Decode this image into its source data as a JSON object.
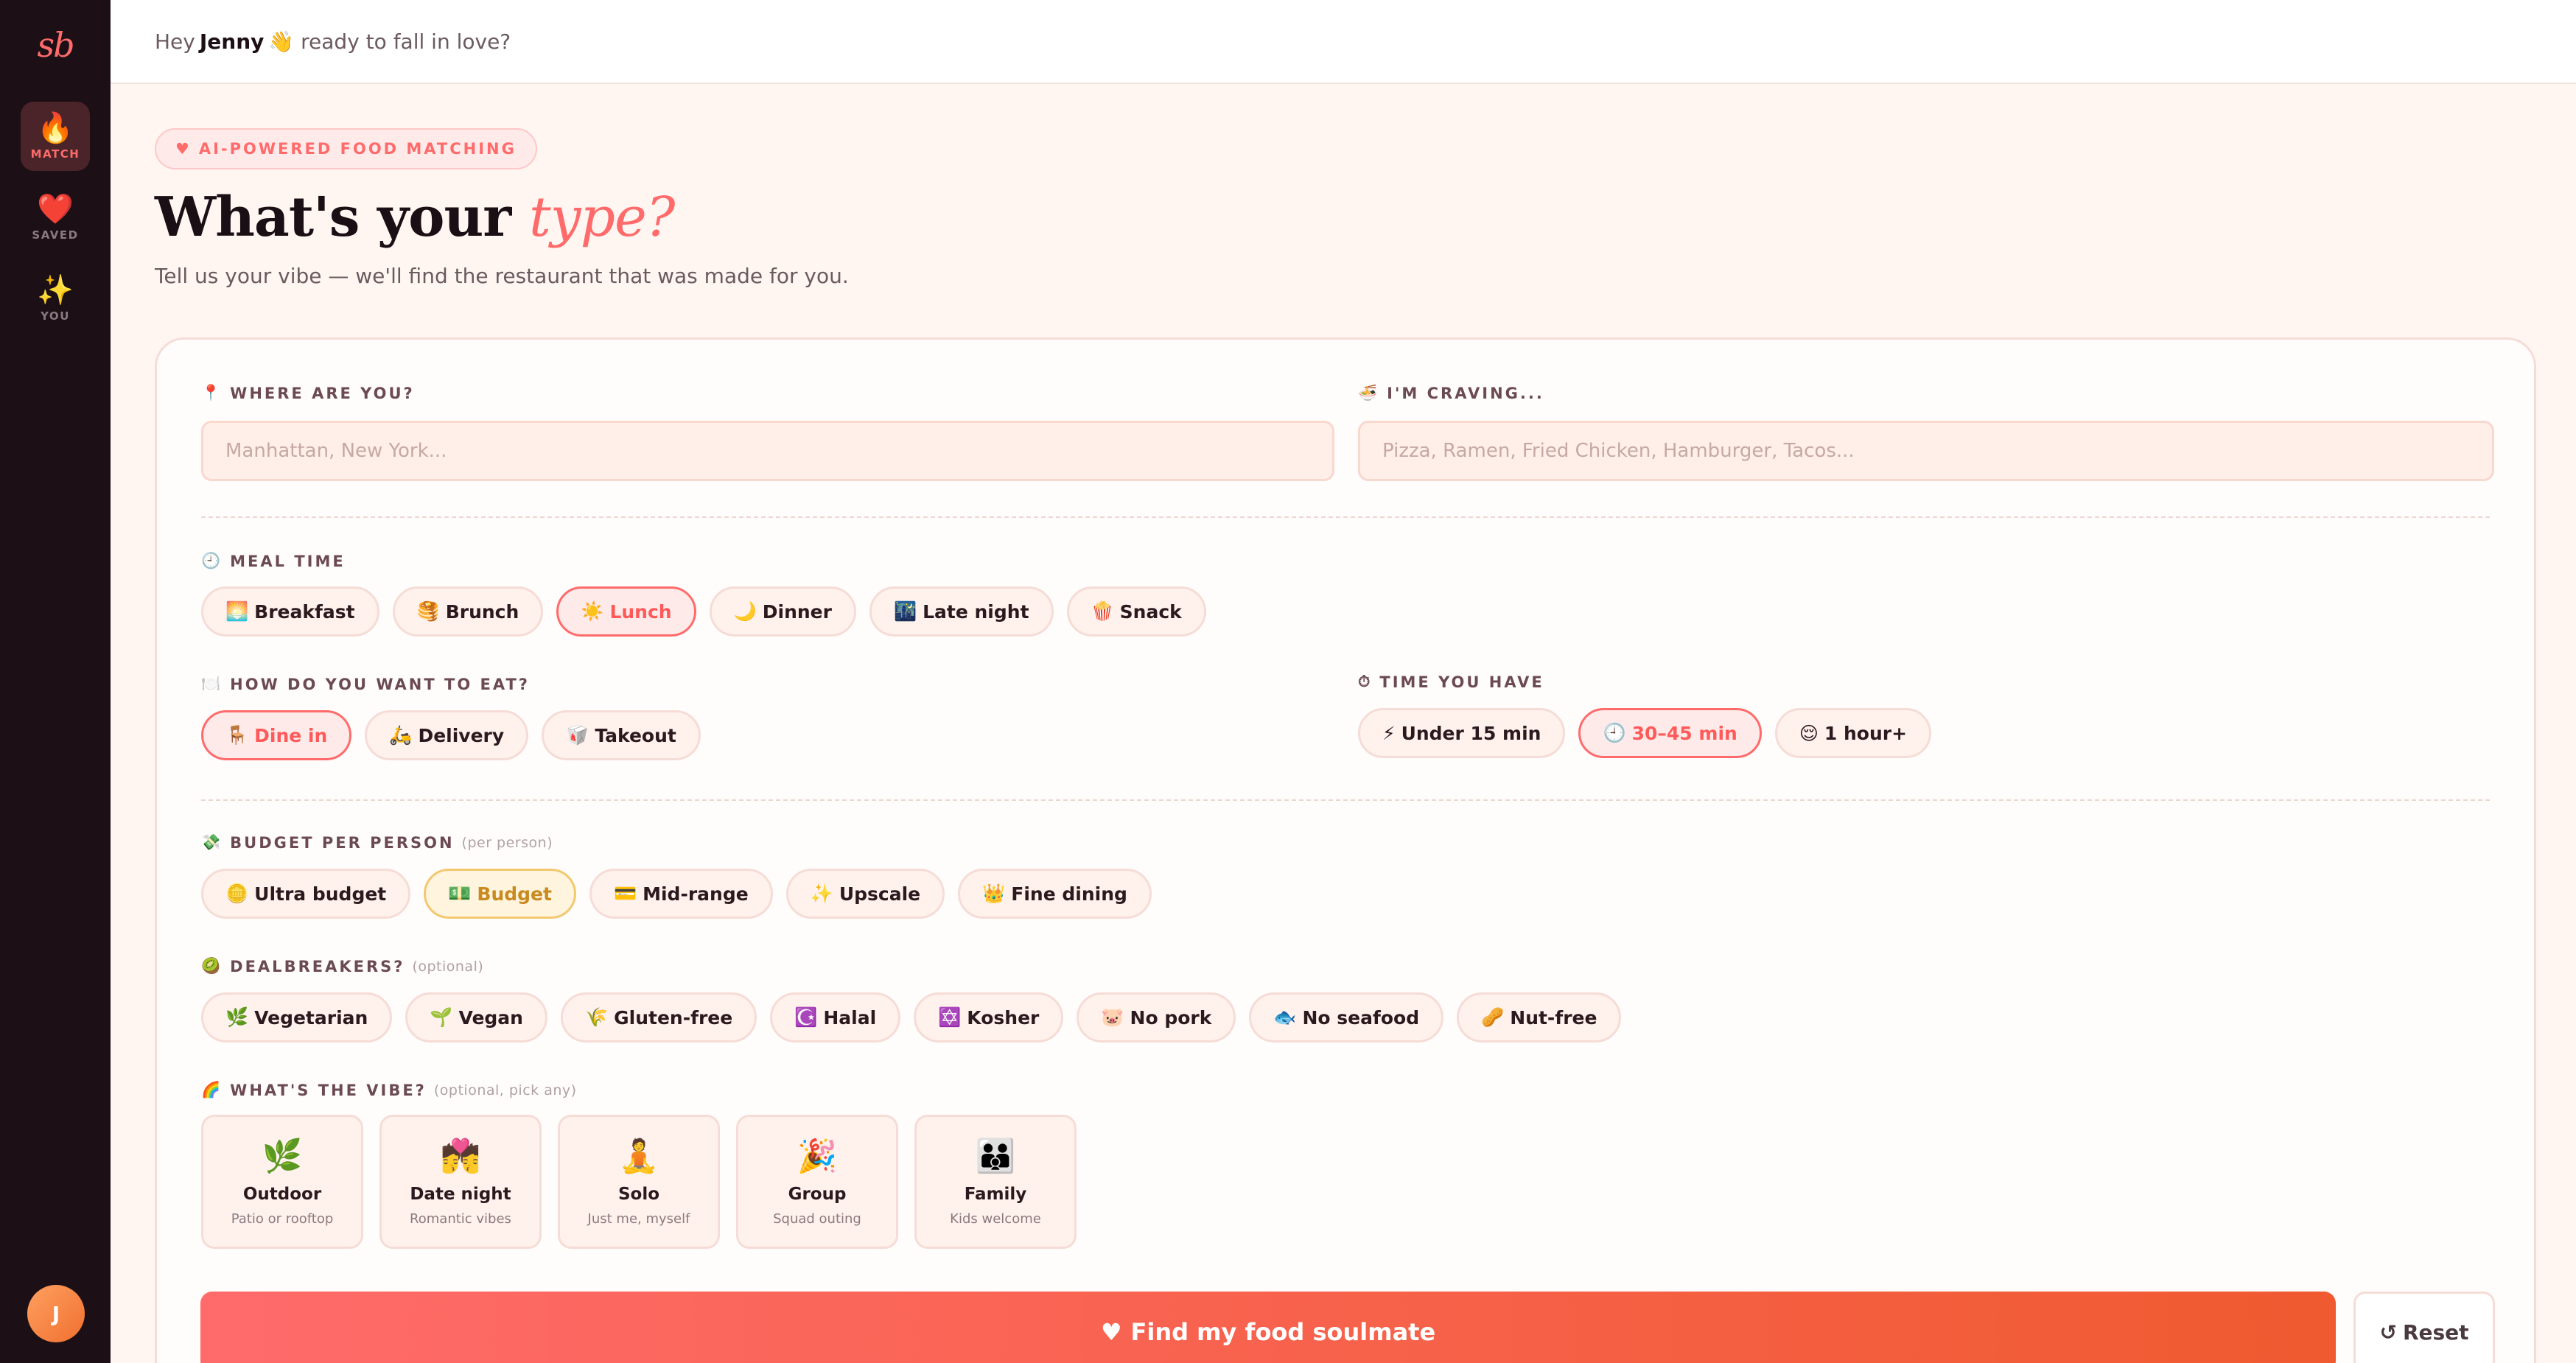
{
  "sidebar": {
    "logo": "sb",
    "items": [
      {
        "icon": "🔥",
        "label": "MATCH"
      },
      {
        "icon": "❤️",
        "label": "SAVED"
      },
      {
        "icon": "✨",
        "label": "YOU"
      }
    ],
    "avatar": "J"
  },
  "topbar": {
    "greeting_pre": "Hey",
    "name": "Jenny",
    "greeting_post": "👋 ready to fall in love?"
  },
  "hero": {
    "badge_icon": "♥",
    "badge": "AI-POWERED FOOD MATCHING",
    "title_main": "What's your",
    "title_accent": "type?",
    "subtitle": "Tell us your vibe — we'll find the restaurant that was made for you."
  },
  "form": {
    "location": {
      "icon": "📍",
      "label": "WHERE ARE YOU?",
      "placeholder": "Manhattan, New York...",
      "value": ""
    },
    "craving": {
      "icon": "🍜",
      "label": "I'M CRAVING...",
      "placeholder": "Pizza, Ramen, Fried Chicken, Hamburger, Tacos...",
      "value": ""
    },
    "meal_time": {
      "icon": "🕘",
      "label": "MEAL TIME",
      "selected": "Lunch",
      "options": [
        {
          "icon": "🌅",
          "label": "Breakfast"
        },
        {
          "icon": "🥞",
          "label": "Brunch"
        },
        {
          "icon": "☀️",
          "label": "Lunch"
        },
        {
          "icon": "🌙",
          "label": "Dinner"
        },
        {
          "icon": "🌃",
          "label": "Late night"
        },
        {
          "icon": "🍿",
          "label": "Snack"
        }
      ]
    },
    "eat_mode": {
      "icon": "🍽️",
      "label": "HOW DO YOU WANT TO EAT?",
      "selected": "Dine in",
      "options": [
        {
          "icon": "🪑",
          "label": "Dine in"
        },
        {
          "icon": "🛵",
          "label": "Delivery"
        },
        {
          "icon": "🥡",
          "label": "Takeout"
        }
      ]
    },
    "time_available": {
      "icon": "⏱",
      "label": "TIME YOU HAVE",
      "selected": "30–45 min",
      "options": [
        {
          "icon": "⚡",
          "label": "Under 15 min"
        },
        {
          "icon": "🕘",
          "label": "30–45 min"
        },
        {
          "icon": "😌",
          "label": "1 hour+"
        }
      ]
    },
    "budget": {
      "icon": "💸",
      "label": "BUDGET PER PERSON",
      "hint": "(per person)",
      "selected": "Budget",
      "options": [
        {
          "icon": "🪙",
          "label": "Ultra budget"
        },
        {
          "icon": "💵",
          "label": "Budget"
        },
        {
          "icon": "💳",
          "label": "Mid-range"
        },
        {
          "icon": "✨",
          "label": "Upscale"
        },
        {
          "icon": "👑",
          "label": "Fine dining"
        }
      ]
    },
    "dealbreakers": {
      "icon": "🥝",
      "label": "DEALBREAKERS?",
      "hint": "(optional)",
      "options": [
        {
          "icon": "🌿",
          "label": "Vegetarian"
        },
        {
          "icon": "🌱",
          "label": "Vegan"
        },
        {
          "icon": "🌾",
          "label": "Gluten-free"
        },
        {
          "icon": "☪️",
          "label": "Halal"
        },
        {
          "icon": "✡️",
          "label": "Kosher"
        },
        {
          "icon": "🐷",
          "label": "No pork"
        },
        {
          "icon": "🐟",
          "label": "No seafood"
        },
        {
          "icon": "🥜",
          "label": "Nut-free"
        }
      ]
    },
    "vibe": {
      "icon": "🌈",
      "label": "WHAT'S THE VIBE?",
      "hint": "(optional, pick any)",
      "options": [
        {
          "icon": "🌿",
          "title": "Outdoor",
          "sub": "Patio or rooftop"
        },
        {
          "icon": "💏",
          "title": "Date night",
          "sub": "Romantic vibes"
        },
        {
          "icon": "🧘",
          "title": "Solo",
          "sub": "Just me, myself"
        },
        {
          "icon": "🎉",
          "title": "Group",
          "sub": "Squad outing"
        },
        {
          "icon": "👪",
          "title": "Family",
          "sub": "Kids welcome"
        }
      ]
    }
  },
  "actions": {
    "find_icon": "♥",
    "find_label": "Find my food soulmate",
    "reset_icon": "↺",
    "reset_label": "Reset"
  },
  "colors": {
    "accent": "#ff6b6b",
    "sidebar_bg": "#1c1016",
    "page_bg": "#fff6f2",
    "gold_selected": "#c98a20"
  }
}
